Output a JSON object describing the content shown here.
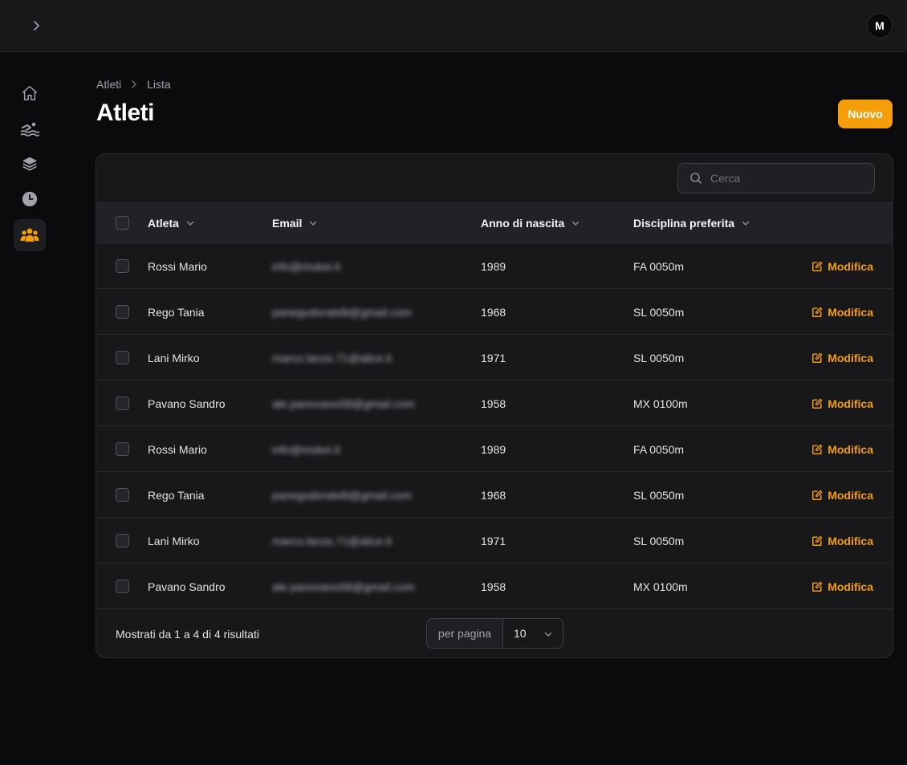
{
  "user": {
    "avatar_initial": "M"
  },
  "sidebar": {
    "items": [
      {
        "name": "home",
        "icon": "home-icon",
        "active": false
      },
      {
        "name": "swimming",
        "icon": "swimmer-icon",
        "active": false
      },
      {
        "name": "layers",
        "icon": "layers-icon",
        "active": false
      },
      {
        "name": "clock",
        "icon": "clock-icon",
        "active": false
      },
      {
        "name": "athletes",
        "icon": "users-icon",
        "active": true
      }
    ]
  },
  "breadcrumb": {
    "parent": "Atleti",
    "current": "Lista"
  },
  "page": {
    "title": "Atleti",
    "new_button": "Nuovo"
  },
  "search": {
    "placeholder": "Cerca"
  },
  "table": {
    "columns": {
      "athlete": "Atleta",
      "email": "Email",
      "birth_year": "Anno di nascita",
      "discipline": "Disciplina preferita"
    },
    "edit_label": "Modifica",
    "rows": [
      {
        "name": "Rossi Mario",
        "email": "info@mokei.it",
        "year": "1989",
        "discipline": "FA 0050m"
      },
      {
        "name": "Rego Tania",
        "email": "panegodoratelli@gmail.com",
        "year": "1968",
        "discipline": "SL 0050m"
      },
      {
        "name": "Lani Mirko",
        "email": "marco.lacos.71@alice.it",
        "year": "1971",
        "discipline": "SL 0050m"
      },
      {
        "name": "Pavano Sandro",
        "email": "ale.panovano58@gmail.com",
        "year": "1958",
        "discipline": "MX 0100m"
      },
      {
        "name": "Rossi Mario",
        "email": "info@mokei.it",
        "year": "1989",
        "discipline": "FA 0050m"
      },
      {
        "name": "Rego Tania",
        "email": "panegodoratelli@gmail.com",
        "year": "1968",
        "discipline": "SL 0050m"
      },
      {
        "name": "Lani Mirko",
        "email": "marco.lacos.71@alice.it",
        "year": "1971",
        "discipline": "SL 0050m"
      },
      {
        "name": "Pavano Sandro",
        "email": "ale.panovano58@gmail.com",
        "year": "1958",
        "discipline": "MX 0100m"
      }
    ]
  },
  "pagination": {
    "summary": "Mostrati da 1 a 4 di 4 risultati",
    "per_page_label": "per pagina",
    "per_page_value": "10"
  },
  "colors": {
    "accent": "#f59e0b",
    "background": "#0b0b0d",
    "surface": "#18181b"
  }
}
